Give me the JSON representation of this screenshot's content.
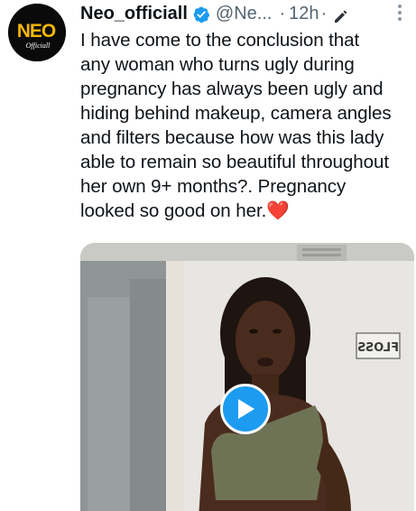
{
  "tweet": {
    "author": {
      "display_name": "Neo_officiall",
      "handle": "@Ne...",
      "verified": true,
      "avatar_text": "NEO",
      "avatar_subtext": "Officiall"
    },
    "time": "12h",
    "separator": "·",
    "text_lines": [
      "I have come to the conclusion that",
      "any woman who turns ugly during",
      "pregnancy has always been ugly and",
      "hiding behind makeup, camera angles",
      "and filters because how was this lady",
      "able to remain so beautiful throughout",
      "her own 9+ months?. Pregnancy",
      "looked so good on her."
    ],
    "heart_emoji": "❤️",
    "media": {
      "type": "video",
      "sign_text": "FLOSS",
      "play_icon": "play-icon"
    },
    "icons": {
      "verified": "verified-badge-icon",
      "edit": "edit-pencil-icon",
      "more": "more-options-icon"
    },
    "colors": {
      "verified_badge": "#1d9bf0",
      "play_button": "#1d9bf0",
      "secondary_text": "#536471",
      "heart": "#e0245e"
    }
  }
}
